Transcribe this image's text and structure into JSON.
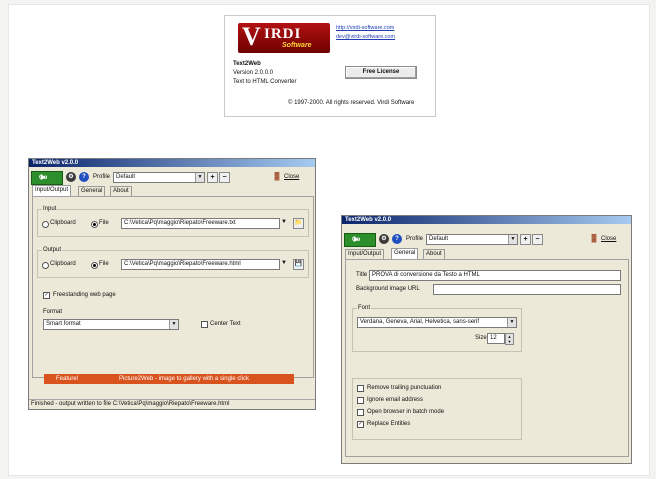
{
  "about": {
    "logo_letter": "V",
    "logo_name": "IRDI",
    "logo_sub": "Software",
    "url1": "http://virdi-software.com",
    "url2": "dev@virdi-software.com",
    "app": "Text2Web",
    "version": "Version 2.0.0.0",
    "desc": "Text to HTML Converter",
    "license": "Free License",
    "copyright": "© 1997-2000. All rights reserved. Virdi Software"
  },
  "main": {
    "title": "Text2Web v2.0.0",
    "go": "Go",
    "profile_label": "Profile",
    "profile": "Default",
    "close": "Close",
    "tabs": [
      "Input/Output",
      "General",
      "About"
    ],
    "input_label": "Input",
    "clipboard": "Clipboard",
    "file": "File",
    "input_path": "C:\\Vetica\\Pq\\maggio\\Riepato\\Freeware.txt",
    "output_label": "Output",
    "output_path": "C:\\Vetica\\Pq\\maggio\\Riepato\\Freeware.html",
    "freestanding": "Freestanding web page",
    "format_label": "Format",
    "format": "Smart format",
    "center": "Center Text",
    "banner_left": "Feature!",
    "banner_right": "Picture2Web - image to gallery with a single click",
    "status": "Finished - output written to file C:\\Vetica\\Pq\\maggio\\Riepato\\Freeware.html"
  },
  "general": {
    "title": "Text2Web v2.0.0",
    "go": "Go",
    "profile_label": "Profile",
    "profile": "Default",
    "close": "Close",
    "tabs": [
      "Input/Output",
      "General",
      "About"
    ],
    "title_label": "Title",
    "title_value": "PROVA di conversione da Testo a HTML",
    "bg_label": "Background image URL",
    "font_label": "Font",
    "font": "Verdana, Geneva, Arial, Helvetica, sans-serif",
    "size_label": "Size",
    "size": "12",
    "options": [
      "Remove trailing punctuation",
      "Ignore email address",
      "Open browser in batch mode",
      "Replace Entities"
    ],
    "checked": [
      false,
      false,
      false,
      true
    ]
  },
  "icons": {
    "go": "go-icon",
    "gear": "gear-icon",
    "help": "help-icon",
    "close": "door-icon",
    "folder": "folder-icon",
    "save": "disk-icon"
  }
}
